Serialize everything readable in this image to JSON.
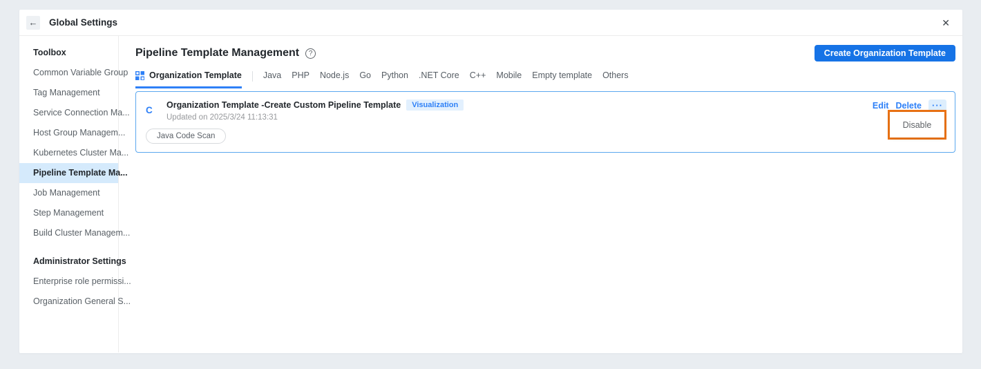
{
  "icons": {
    "back": "←",
    "close": "✕",
    "help": "?",
    "more": "···"
  },
  "colors": {
    "accent_blue": "#1673e6",
    "link_blue": "#2e80f7",
    "selected_item_bg": "#d5eafc",
    "card_border": "#5aa7ef",
    "badge_bg": "#e2f0fe",
    "annotation_orange": "#ee7414",
    "page_bg": "#e9edf1"
  },
  "header": {
    "title": "Global Settings"
  },
  "sidebar": {
    "selected": "Pipeline Template Ma...",
    "sections": [
      {
        "header": "Toolbox",
        "items": [
          "Common Variable Group",
          "Tag Management",
          "Service Connection Ma...",
          "Host Group Managem...",
          "Kubernetes Cluster Ma...",
          "Pipeline Template Ma...",
          "Job Management",
          "Step Management",
          "Build Cluster Managem..."
        ]
      },
      {
        "header": "Administrator Settings",
        "items": [
          "Enterprise role permissi...",
          "Organization General S..."
        ]
      }
    ]
  },
  "main": {
    "title": "Pipeline Template Management",
    "create_button": "Create Organization Template",
    "active_tab": "Organization Template",
    "tabs": [
      "Organization Template",
      "Java",
      "PHP",
      "Node.js",
      "Go",
      "Python",
      ".NET Core",
      "C++",
      "Mobile",
      "Empty template",
      "Others"
    ]
  },
  "template_card": {
    "icon_letter": "C",
    "title": "Organization Template -Create Custom Pipeline Template",
    "badge": "Visualization",
    "updated": "Updated on 2025/3/24 11:13:31",
    "tag": "Java Code Scan",
    "edit_label": "Edit",
    "delete_label": "Delete",
    "menu_disable_label": "Disable"
  }
}
